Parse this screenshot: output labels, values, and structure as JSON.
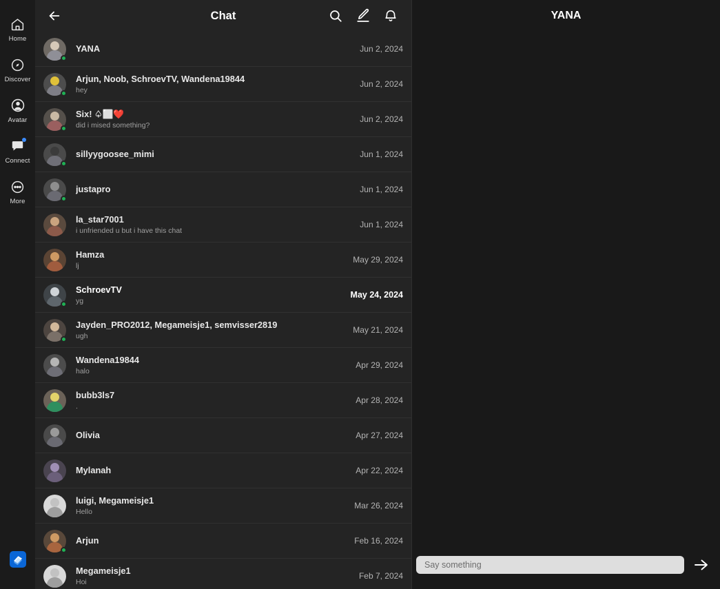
{
  "rail": {
    "items": [
      {
        "label": "Home",
        "icon": "home-icon",
        "badge": false
      },
      {
        "label": "Discover",
        "icon": "compass-icon",
        "badge": false
      },
      {
        "label": "Avatar",
        "icon": "avatar-person-icon",
        "badge": false
      },
      {
        "label": "Connect",
        "icon": "chat-bubble-icon",
        "badge": true
      },
      {
        "label": "More",
        "icon": "more-ellipsis-icon",
        "badge": false
      }
    ],
    "logo_icon": "roblox-logo-icon"
  },
  "chat_panel": {
    "title": "Chat",
    "back_icon": "back-arrow-icon",
    "actions": [
      {
        "name": "search-icon",
        "label": "Search"
      },
      {
        "name": "compose-icon",
        "label": "New chat"
      },
      {
        "name": "notification-bell-icon",
        "label": "Notifications"
      }
    ],
    "rows": [
      {
        "name": "YANA",
        "preview": "",
        "date": "Jun 2, 2024",
        "unread": false,
        "presence": "online",
        "avatar_color": "#6f6a64",
        "head_color": "#d6c9b8",
        "body_color": "#8f8f97"
      },
      {
        "name": "Arjun, Noob, SchroevTV, Wandena19844",
        "preview": "hey",
        "date": "Jun 2, 2024",
        "unread": false,
        "presence": "online",
        "avatar_color": "#4d4d4d",
        "head_color": "#e0c13a",
        "body_color": "#7e7e86"
      },
      {
        "name": "Six! ♤⬜❤️",
        "preview": "did i mised something?",
        "date": "Jun 2, 2024",
        "unread": false,
        "presence": "online",
        "avatar_color": "#55504b",
        "head_color": "#c9b9a4",
        "body_color": "#9a5f5f"
      },
      {
        "name": "sillyygoosee_mimi",
        "preview": "",
        "date": "Jun 1, 2024",
        "unread": false,
        "presence": "online",
        "avatar_color": "#4a4a4a",
        "head_color": "#3b3b3b",
        "body_color": "#6f6f77"
      },
      {
        "name": "justapro",
        "preview": "",
        "date": "Jun 1, 2024",
        "unread": false,
        "presence": "online",
        "avatar_color": "#4a4a4a",
        "head_color": "#8e8e8e",
        "body_color": "#6a6a72"
      },
      {
        "name": "la_star7001",
        "preview": "i unfriended u but i have this chat",
        "date": "Jun 1, 2024",
        "unread": false,
        "presence": "none",
        "avatar_color": "#5a4a3e",
        "head_color": "#caa47f",
        "body_color": "#8c5a4a"
      },
      {
        "name": "Hamza",
        "preview": "lj",
        "date": "May 29, 2024",
        "unread": false,
        "presence": "none",
        "avatar_color": "#5b4434",
        "head_color": "#cf9a63",
        "body_color": "#a05c3e"
      },
      {
        "name": "SchroevTV",
        "preview": "yg",
        "date": "May 24, 2024",
        "unread": true,
        "presence": "online",
        "avatar_color": "#3f4448",
        "head_color": "#cfd4d8",
        "body_color": "#5e666c"
      },
      {
        "name": "Jayden_PRO2012, Megameisje1, semvisser2819",
        "preview": "ugh",
        "date": "May 21, 2024",
        "unread": false,
        "presence": "online",
        "avatar_color": "#4d4540",
        "head_color": "#d2b89a",
        "body_color": "#7a7068"
      },
      {
        "name": "Wandena19844",
        "preview": "halo",
        "date": "Apr 29, 2024",
        "unread": false,
        "presence": "none",
        "avatar_color": "#4c4c4c",
        "head_color": "#b5b5b5",
        "body_color": "#6e6e76"
      },
      {
        "name": "bubb3ls7",
        "preview": ".",
        "date": "Apr 28, 2024",
        "unread": false,
        "presence": "none",
        "avatar_color": "#6b6258",
        "head_color": "#e3d36a",
        "body_color": "#2f8f5f"
      },
      {
        "name": "Olivia",
        "preview": "",
        "date": "Apr 27, 2024",
        "unread": false,
        "presence": "none",
        "avatar_color": "#4a4a4a",
        "head_color": "#9a9a9a",
        "body_color": "#6a6a72"
      },
      {
        "name": "Mylanah",
        "preview": "",
        "date": "Apr 22, 2024",
        "unread": false,
        "presence": "none",
        "avatar_color": "#4a4450",
        "head_color": "#a08fb5",
        "body_color": "#6b5f7a"
      },
      {
        "name": "luigi, Megameisje1",
        "preview": "Hello",
        "date": "Mar 26, 2024",
        "unread": false,
        "presence": "none",
        "avatar_color": "#d9d9d9",
        "head_color": "#c2c2c2",
        "body_color": "#9e9e9e"
      },
      {
        "name": "Arjun",
        "preview": "",
        "date": "Feb 16, 2024",
        "unread": false,
        "presence": "online",
        "avatar_color": "#59483a",
        "head_color": "#cf9a63",
        "body_color": "#a8653f"
      },
      {
        "name": "Megameisje1",
        "preview": "Hoi",
        "date": "Feb 7, 2024",
        "unread": false,
        "presence": "none",
        "avatar_color": "#d9d9d9",
        "head_color": "#c2c2c2",
        "body_color": "#9e9e9e"
      }
    ]
  },
  "conversation": {
    "title": "YANA",
    "input_placeholder": "Say something",
    "input_value": "",
    "send_icon": "send-arrow-icon"
  },
  "colors": {
    "accent": "#3b8cff",
    "online": "#1fb155",
    "panel_bg": "#242424",
    "app_bg": "#191919"
  }
}
